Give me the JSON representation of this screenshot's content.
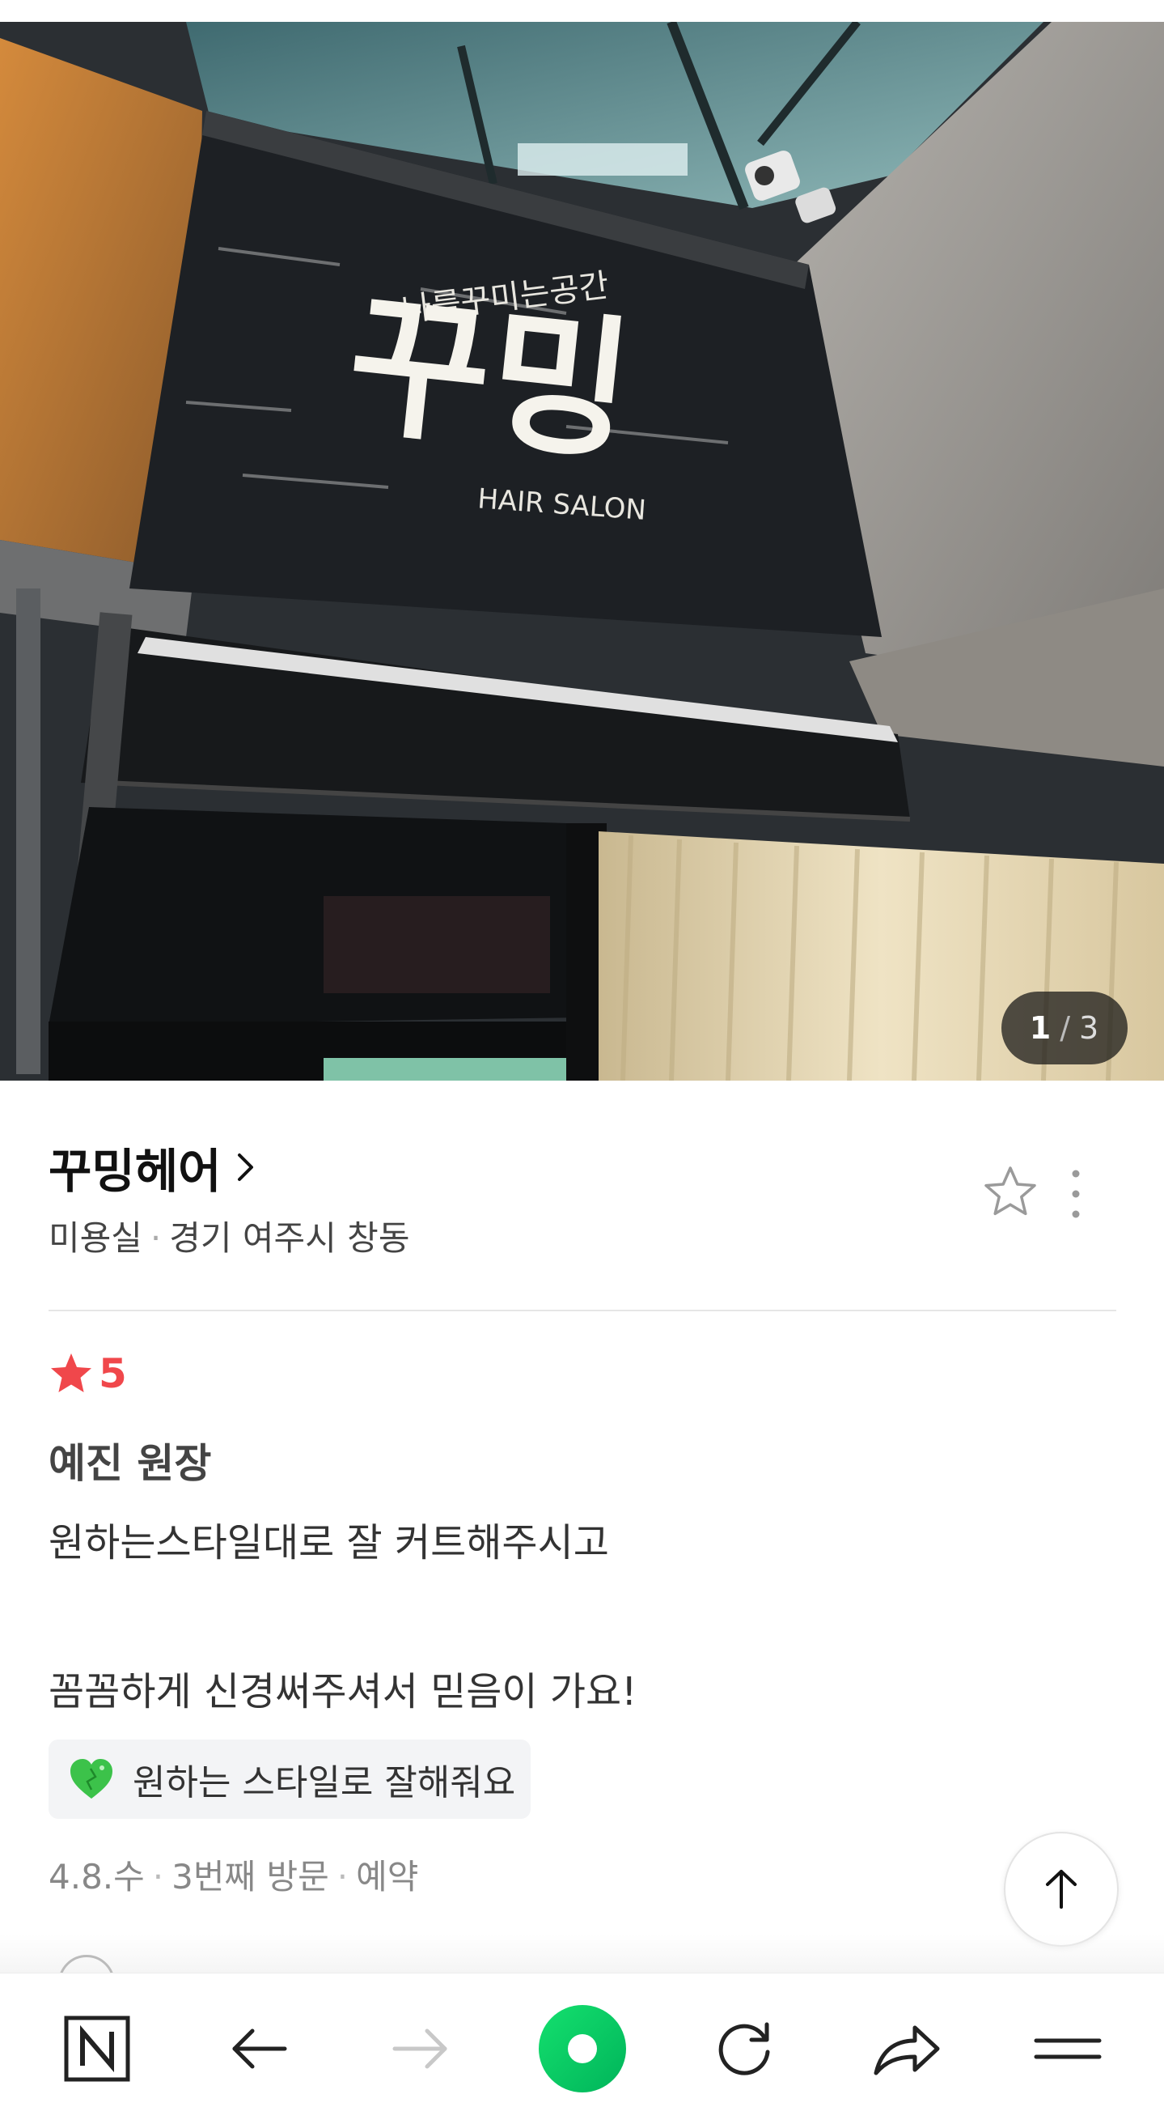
{
  "photo": {
    "sign_small_text": "나를꾸미는공간",
    "sign_big_text": "꾸밍",
    "sign_sub_text": "HAIR SALON",
    "counter_current": "1",
    "counter_separator": "/",
    "counter_total": "3"
  },
  "place": {
    "name": "꾸밍헤어",
    "category": "미용실",
    "separator": "·",
    "location": "경기 여주시 창동"
  },
  "review": {
    "rating": "5",
    "author": "예진 원장",
    "lines": [
      "원하는스타일대로 잘 커트해주시고",
      "꼼꼼하게 신경써주셔서 믿음이 가요!"
    ],
    "tag": "원하는 스타일로 잘해줘요",
    "visit_date": "4.8.수",
    "visit_count": "3번째 방문",
    "visit_type": "예약",
    "separator": "·"
  },
  "colors": {
    "rating_red": "#f0474b",
    "naver_green": "#03cf5d"
  },
  "icons": [
    "star-outline-icon",
    "more-vertical-icon",
    "chevron-right-icon",
    "star-filled-icon",
    "green-heart-icon",
    "arrow-up-icon",
    "naver-n-icon",
    "back-arrow-icon",
    "forward-arrow-icon",
    "green-dot-icon",
    "refresh-icon",
    "share-icon",
    "menu-icon"
  ]
}
